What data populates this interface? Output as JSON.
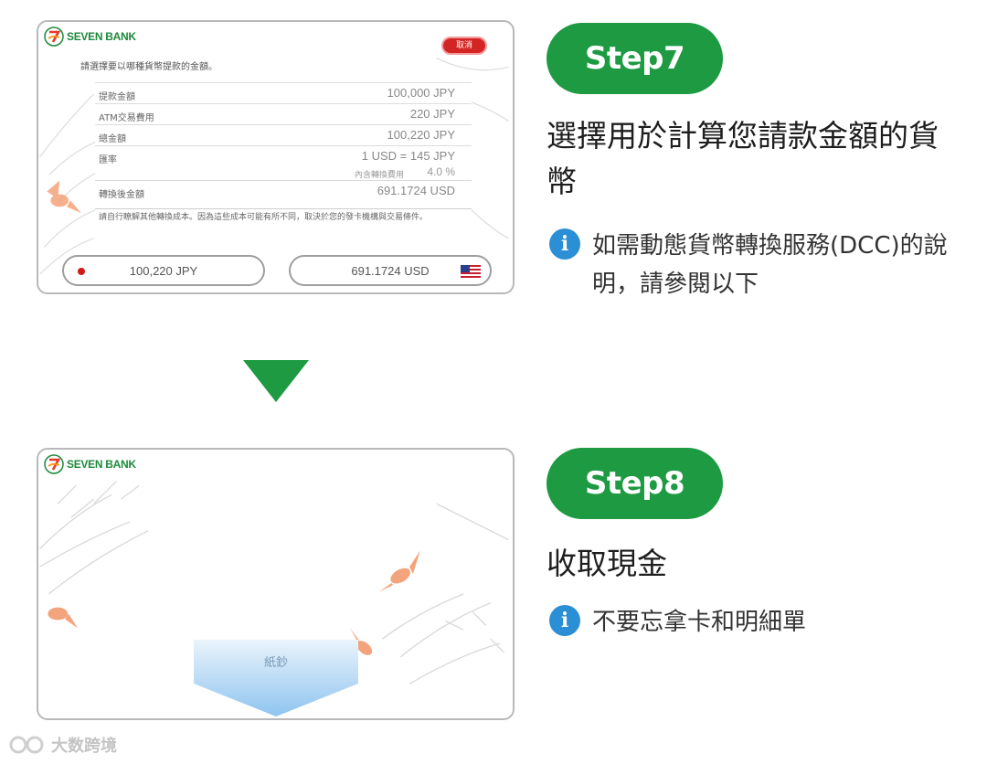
{
  "step7": {
    "badge": "Step7",
    "title": "選擇用於計算您請款金額的貨幣",
    "info_note": "如需動態貨幣轉換服務(DCC)的說明，請參閱以下",
    "atm_screen": {
      "brand": "SEVEN BANK",
      "cancel_label": "取消",
      "instruction": "請選擇要以哪種貨幣提款的金額。",
      "rows": [
        {
          "label": "提款金額",
          "value": "100,000 JPY"
        },
        {
          "label": "ATM交易費用",
          "value": "220 JPY"
        },
        {
          "label": "總金額",
          "value": "100,220 JPY"
        },
        {
          "label": "匯率",
          "value": "1 USD = 145 JPY",
          "sub_label": "內含轉換費用",
          "sub_value": "4.0 %"
        },
        {
          "label": "轉換後金額",
          "value": "691.1724 USD"
        }
      ],
      "note": "請自行瞭解其他轉換成本。因為這些成本可能有所不同，取決於您的發卡機構與交易條件。",
      "options": [
        {
          "amount": "100,220 JPY",
          "flag": "japan-flag"
        },
        {
          "amount": "691.1724 USD",
          "flag": "us-flag"
        }
      ]
    }
  },
  "step8": {
    "badge": "Step8",
    "title": "收取現金",
    "info_note": "不要忘拿卡和明細單",
    "atm_screen": {
      "brand": "SEVEN BANK",
      "cash_label": "紙鈔"
    }
  },
  "info_icon_glyph": "i",
  "watermark": "大数跨境",
  "colors": {
    "step_green": "#1d9a42",
    "info_blue": "#2b8fd6",
    "cancel_red": "#d42525",
    "brand_green": "#1b8a3a"
  }
}
